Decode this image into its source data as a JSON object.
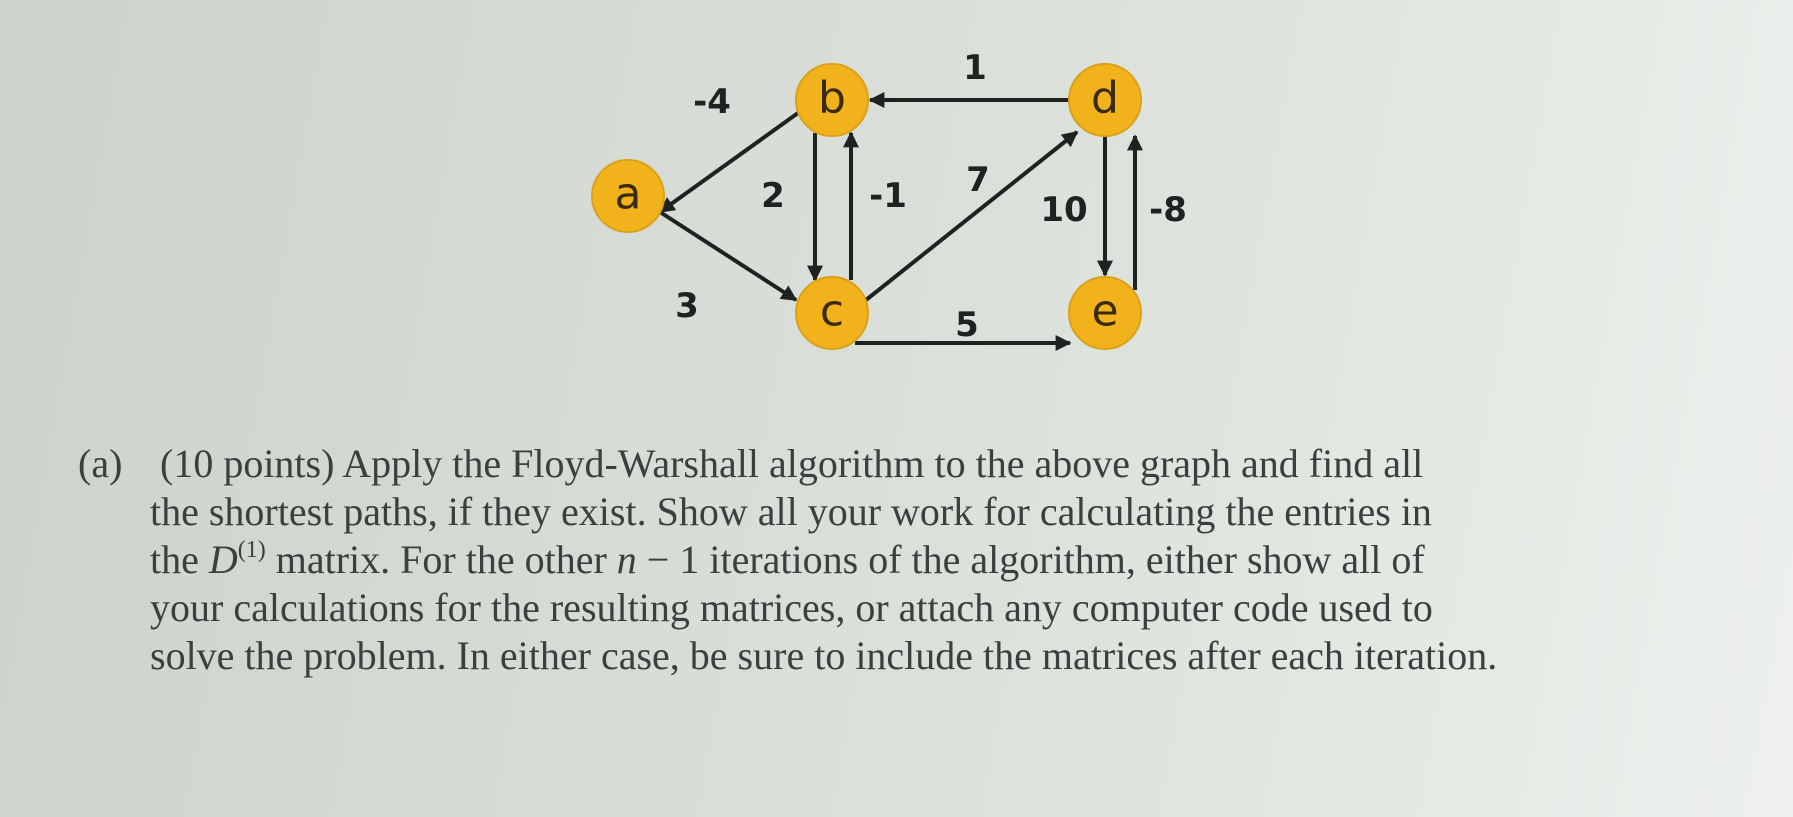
{
  "graph": {
    "nodes": [
      {
        "id": "a",
        "label": "a"
      },
      {
        "id": "b",
        "label": "b"
      },
      {
        "id": "c",
        "label": "c"
      },
      {
        "id": "d",
        "label": "d"
      },
      {
        "id": "e",
        "label": "e"
      }
    ],
    "edges": [
      {
        "from": "b",
        "to": "a",
        "weight": "-4"
      },
      {
        "from": "a",
        "to": "c",
        "weight": "3"
      },
      {
        "from": "b",
        "to": "c",
        "weight": "2"
      },
      {
        "from": "c",
        "to": "b",
        "weight": "-1"
      },
      {
        "from": "d",
        "to": "b",
        "weight": "1"
      },
      {
        "from": "c",
        "to": "d",
        "weight": "7"
      },
      {
        "from": "c",
        "to": "e",
        "weight": "5"
      },
      {
        "from": "d",
        "to": "e",
        "weight": "10"
      },
      {
        "from": "e",
        "to": "d",
        "weight": "-8"
      }
    ],
    "colors": {
      "node_fill": "#f2b21b",
      "edge": "#1e2220"
    }
  },
  "problem": {
    "part_label": "(a)",
    "points": "(10 points)",
    "line1": "Apply the Floyd-Warshall algorithm to the above graph and find all",
    "line2": "the shortest paths, if they exist. Show all your work for calculating the entries in",
    "line3_pre": "the",
    "line3_matrix": "D",
    "line3_sup": "(1)",
    "line3_mid": "matrix. For the other",
    "line3_var": "n",
    "line3_post": "− 1 iterations of the algorithm, either show all of",
    "line4": "your calculations for the resulting matrices, or attach any computer code used to",
    "line5": "solve the problem. In either case, be sure to include the matrices after each iteration."
  }
}
